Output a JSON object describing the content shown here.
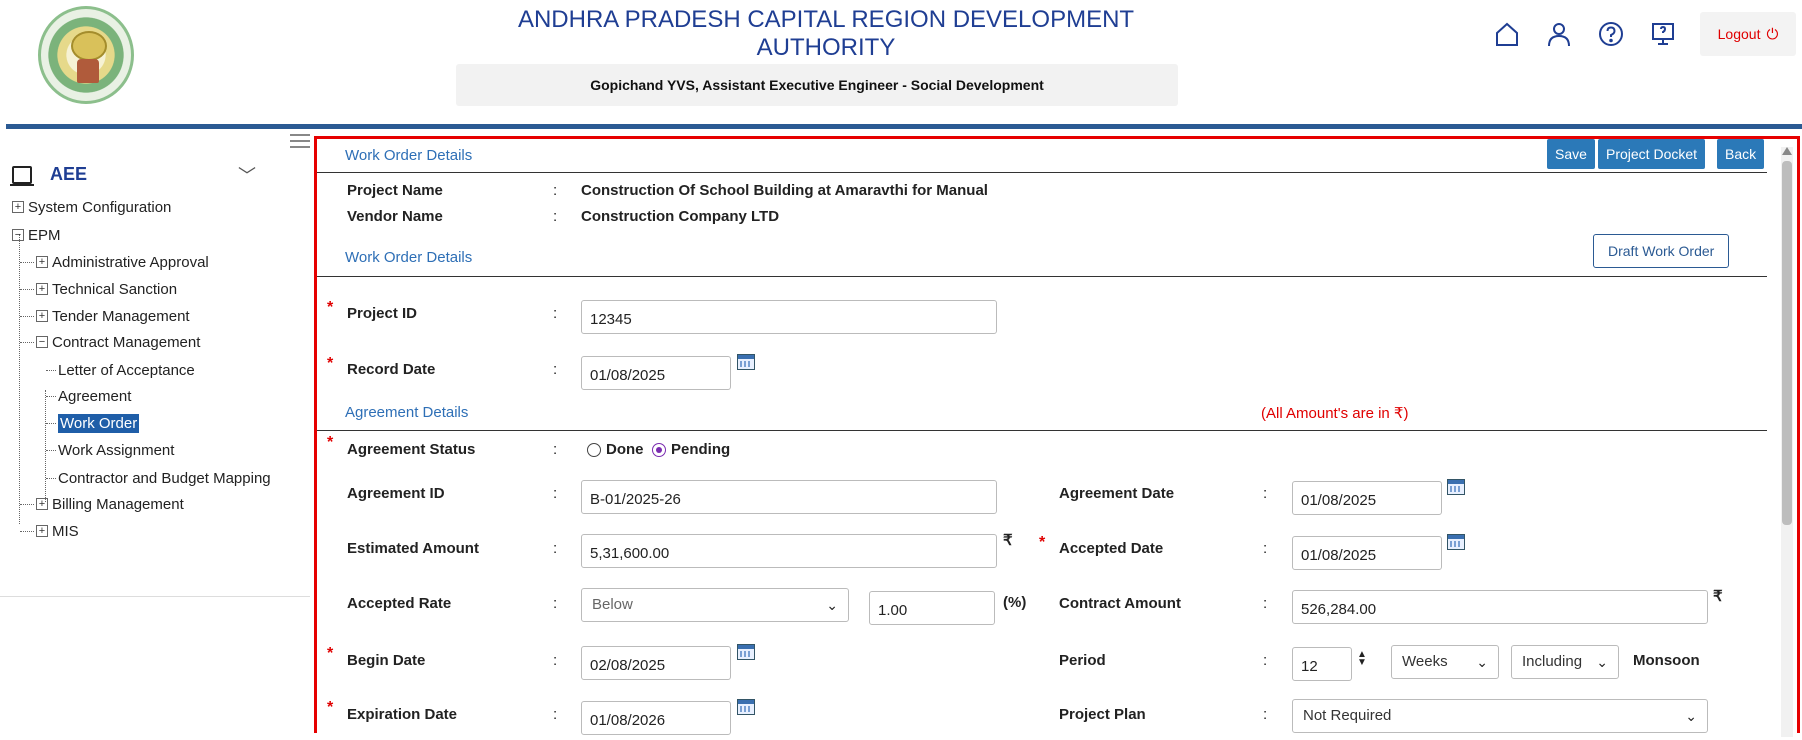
{
  "header": {
    "org_line1": "ANDHRA PRADESH CAPITAL REGION DEVELOPMENT",
    "org_line2": "AUTHORITY",
    "user_info": "Gopichand YVS, Assistant Executive Engineer - Social Development",
    "logout_label": "Logout"
  },
  "sidebar": {
    "role": "AEE",
    "items": {
      "system_configuration": "System Configuration",
      "epm": "EPM",
      "administrative_approval": "Administrative Approval",
      "technical_sanction": "Technical Sanction",
      "tender_management": "Tender Management",
      "contract_management": "Contract Management",
      "letter_of_acceptance": "Letter of Acceptance",
      "agreement": "Agreement",
      "work_order": "Work Order",
      "work_assignment": "Work Assignment",
      "contractor_budget_mapping": "Contractor and Budget Mapping",
      "billing_management": "Billing Management",
      "mis": "MIS"
    }
  },
  "main": {
    "title": "Work Order Details",
    "buttons": {
      "save": "Save",
      "project_docket": "Project Docket",
      "back": "Back",
      "draft": "Draft Work Order"
    },
    "project_name_label": "Project Name",
    "project_name": "Construction Of School Building at Amaravthi for Manual",
    "vendor_name_label": "Vendor Name",
    "vendor_name": "Construction Company LTD",
    "sub_title": "Work Order Details",
    "colon": ":",
    "project_id_label": "Project ID",
    "project_id": "12345",
    "record_date_label": "Record Date",
    "record_date": "01/08/2025",
    "agreement_details_title": "Agreement Details",
    "amount_note": "(All Amount's are in ₹)",
    "agreement_status_label": "Agreement Status",
    "status_done": "Done",
    "status_pending": "Pending",
    "agreement_id_label": "Agreement ID",
    "agreement_id": "B-01/2025-26",
    "agreement_date_label": "Agreement Date",
    "agreement_date": "01/08/2025",
    "estimated_amount_label": "Estimated Amount",
    "estimated_amount": "5,31,600.00",
    "accepted_date_label": "Accepted Date",
    "accepted_date": "01/08/2025",
    "accepted_rate_label": "Accepted Rate",
    "accepted_rate_option": "Below",
    "accepted_rate_value": "1.00",
    "percent": "(%)",
    "contract_amount_label": "Contract Amount",
    "contract_amount": "526,284.00",
    "begin_date_label": "Begin Date",
    "begin_date": "02/08/2025",
    "period_label": "Period",
    "period_value": "12",
    "period_unit": "Weeks",
    "monsoon_option": "Including",
    "monsoon_label": "Monsoon",
    "expiration_date_label": "Expiration Date",
    "expiration_date": "01/08/2026",
    "project_plan_label": "Project Plan",
    "project_plan": "Not Required",
    "rupee": "₹",
    "required": "*"
  }
}
